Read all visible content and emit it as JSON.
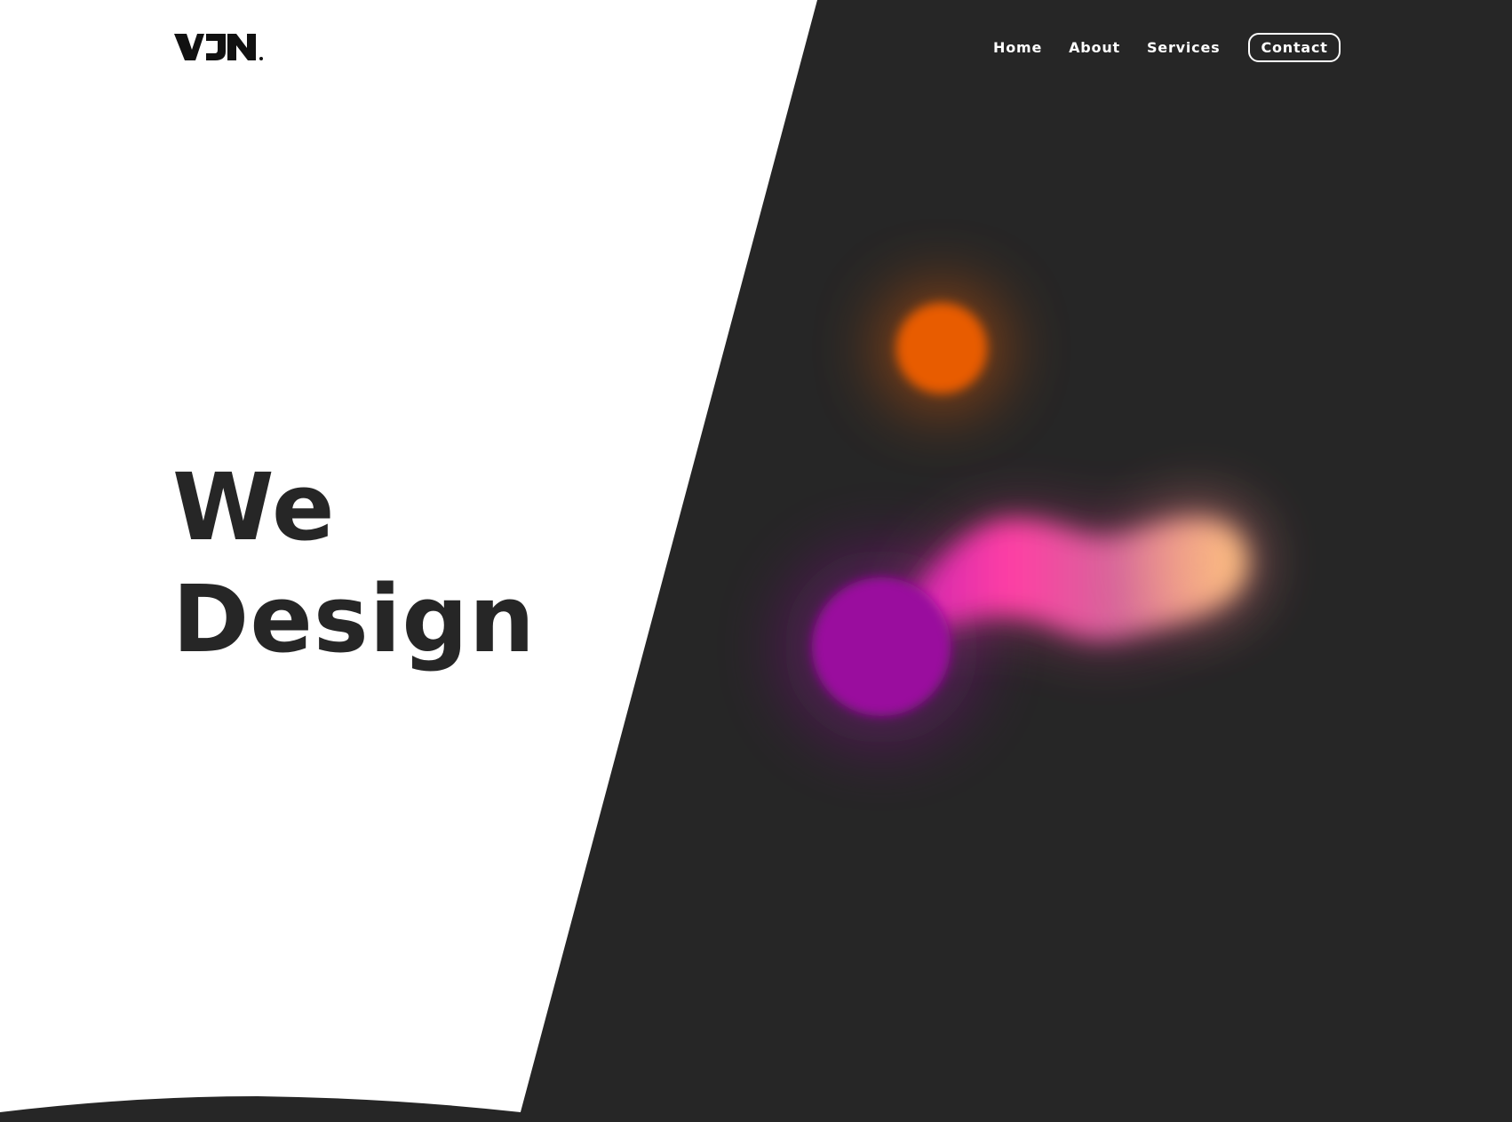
{
  "brand": {
    "logo_text": "VJN",
    "logo_icon": "vjn-wordmark-icon"
  },
  "nav": {
    "items": [
      {
        "label": "Home"
      },
      {
        "label": "About"
      },
      {
        "label": "Services"
      }
    ],
    "contact_label": "Contact"
  },
  "hero": {
    "line1": "We",
    "line2": "Design"
  },
  "colors": {
    "background_light": "#ffffff",
    "background_dark": "#262626",
    "text_dark": "#262626",
    "blob_orange": "#e85c00",
    "blob_pink": "#ff3fa4",
    "blob_purple": "#9a0f9e",
    "blob_peach": "#ffc37f"
  },
  "decor": {
    "blobs": [
      "orange-blob",
      "purple-blob",
      "pink-blob",
      "peach-blob"
    ]
  }
}
